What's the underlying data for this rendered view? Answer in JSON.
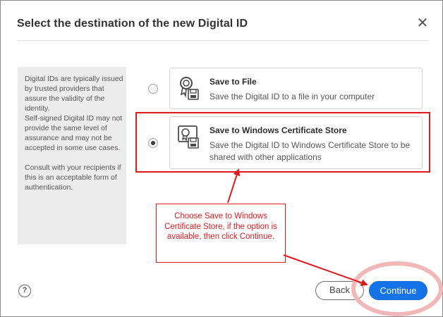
{
  "dialog": {
    "title": "Select the destination of the new Digital ID",
    "close_glyph": "✕"
  },
  "info_panel": {
    "text": "Digital IDs are typically issued by trusted providers that assure the validity of the identity.\nSelf-signed Digital ID may not provide the same level of assurance and may not be accepted in some use cases.\n\nConsult with your recipients if this is an acceptable form of authentication."
  },
  "options": [
    {
      "title": "Save to File",
      "description": "Save the Digital ID to a file in your computer",
      "icon": "certificate-icon",
      "selected": false
    },
    {
      "title": "Save to Windows Certificate Store",
      "description": "Save the Digital ID to Windows Certificate Store to be shared with other applications",
      "icon": "certificate-store-icon",
      "selected": true
    }
  ],
  "annotation": {
    "callout_text": "Choose Save to Windows Certificate Store, if the option is available, then click Continue.",
    "color": "#e0191f",
    "circle_color": "#f2b8b8"
  },
  "footer": {
    "help_glyph": "?",
    "back_label": "Back",
    "continue_label": "Continue"
  },
  "colors": {
    "accent": "#1473e6",
    "panel_bg": "#ececec"
  }
}
